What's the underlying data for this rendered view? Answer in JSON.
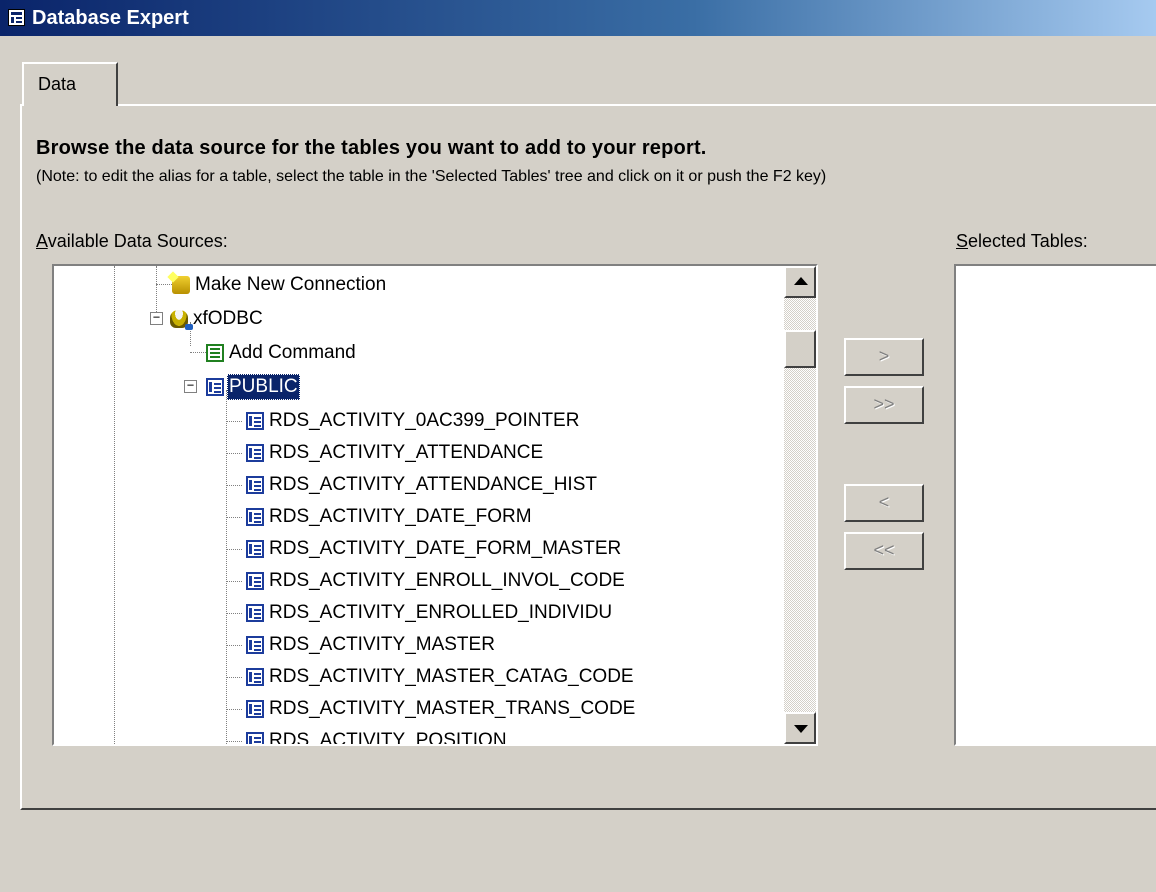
{
  "window": {
    "title": "Database Expert"
  },
  "tabs": [
    {
      "label": "Data"
    }
  ],
  "panel": {
    "heading": "Browse the data source for the tables you want to add to your report.",
    "note": "(Note: to edit the alias for a table, select the table in the 'Selected Tables' tree and click on it or push the F2 key)",
    "available_label_key": "A",
    "available_label_rest": "vailable Data Sources:",
    "selected_label_key": "S",
    "selected_label_rest": "elected Tables:"
  },
  "tree": {
    "make_new_connection": "Make New Connection",
    "connection": "xfODBC",
    "add_command": "Add Command",
    "schema": "PUBLIC",
    "tables": [
      "RDS_ACTIVITY_0AC399_POINTER",
      "RDS_ACTIVITY_ATTENDANCE",
      "RDS_ACTIVITY_ATTENDANCE_HIST",
      "RDS_ACTIVITY_DATE_FORM",
      "RDS_ACTIVITY_DATE_FORM_MASTER",
      "RDS_ACTIVITY_ENROLL_INVOL_CODE",
      "RDS_ACTIVITY_ENROLLED_INDIVIDU",
      "RDS_ACTIVITY_MASTER",
      "RDS_ACTIVITY_MASTER_CATAG_CODE",
      "RDS_ACTIVITY_MASTER_TRANS_CODE",
      "RDS_ACTIVITY_POSITION"
    ]
  },
  "move_buttons": {
    "add_one": ">",
    "add_all": ">>",
    "remove_one": "<",
    "remove_all": "<<"
  },
  "colors": {
    "title_bar": "#0a246a",
    "face": "#d4d0c8",
    "selection": "#0a246a"
  }
}
